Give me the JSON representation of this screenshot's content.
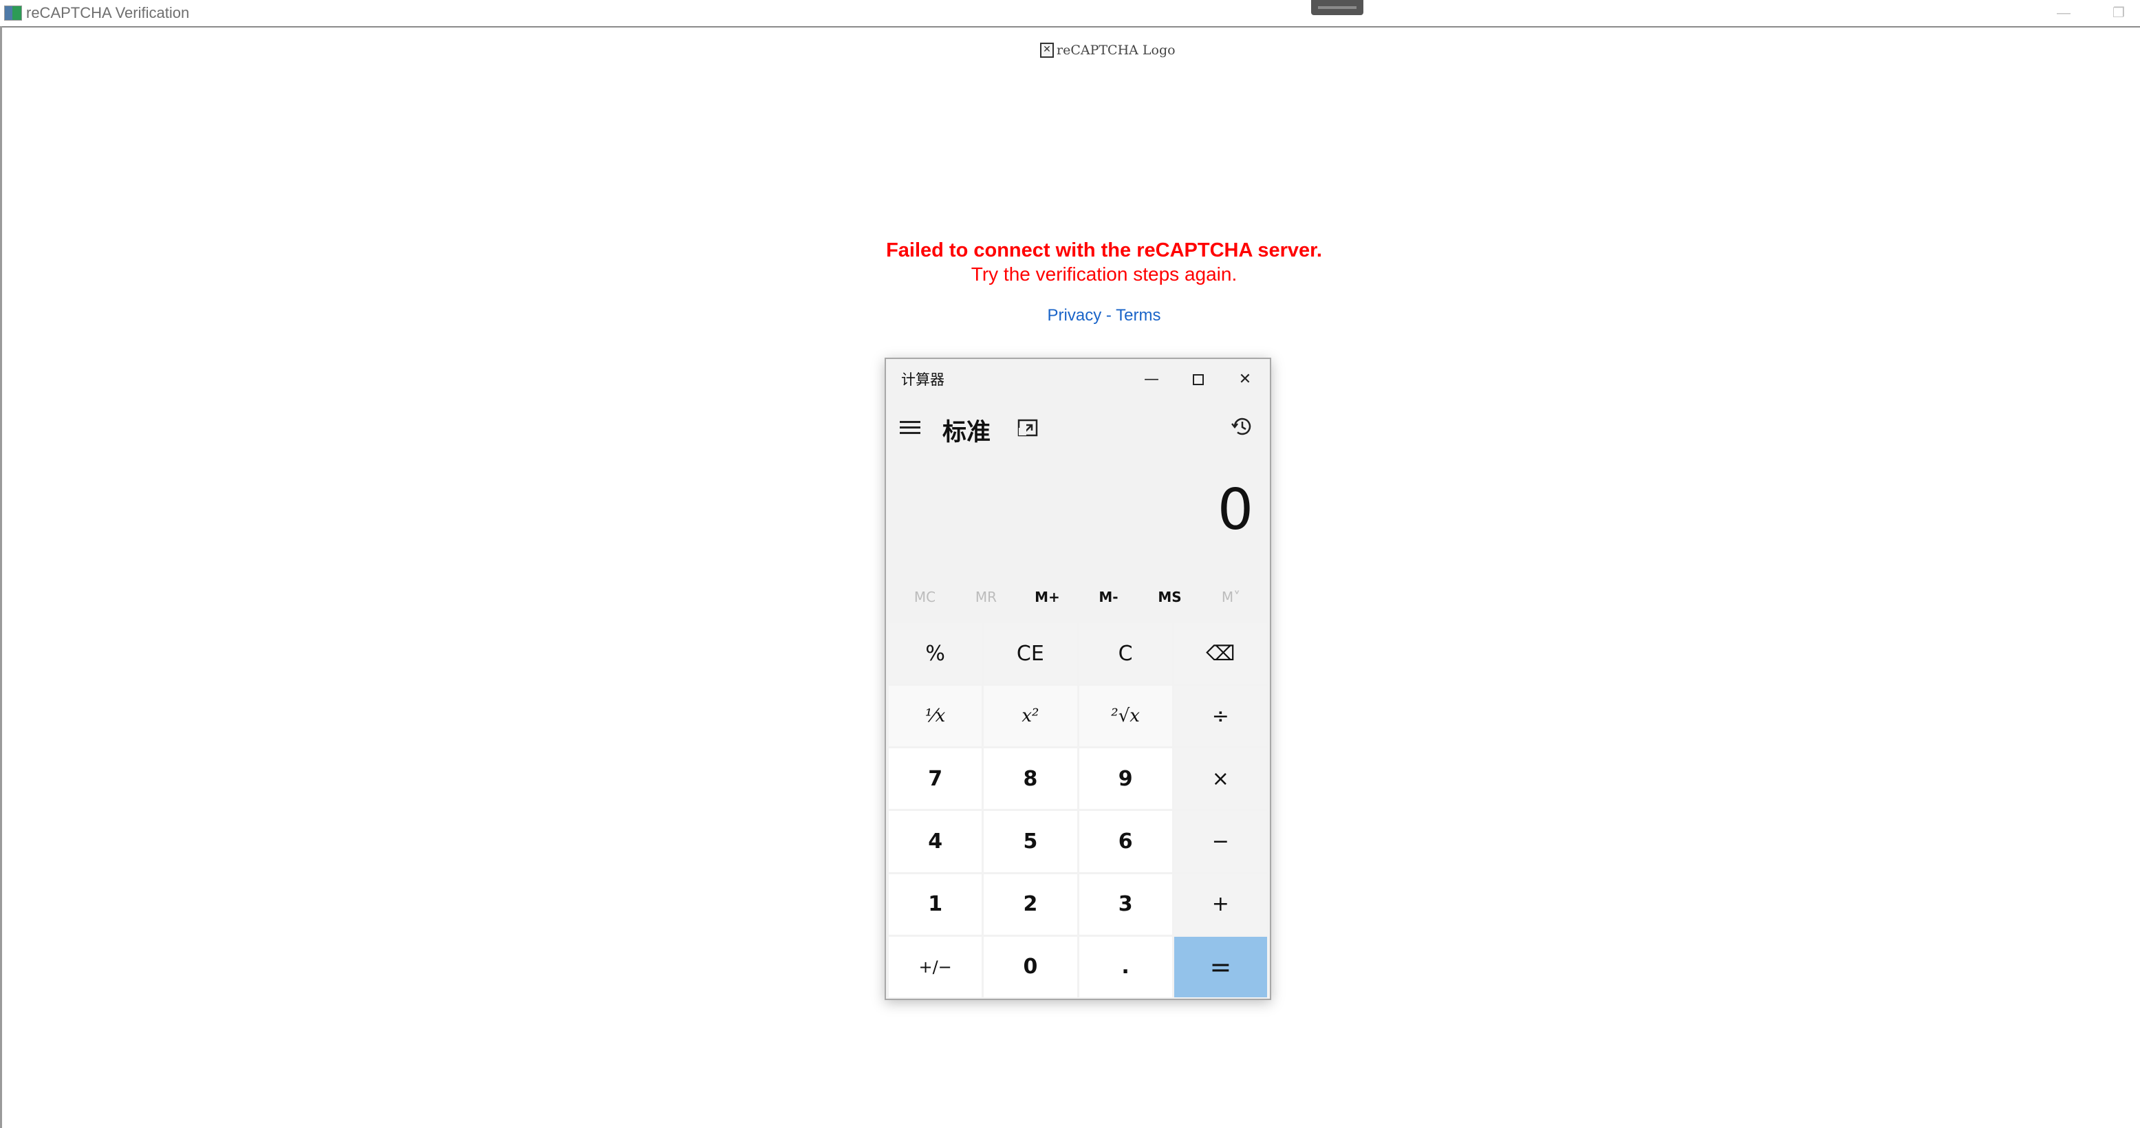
{
  "window": {
    "title": "reCAPTCHA Verification",
    "minimize_glyph": "—",
    "restore_glyph": "❐"
  },
  "page": {
    "logo_alt": "reCAPTCHA Logo",
    "error_title": "Failed to connect with the reCAPTCHA server.",
    "error_subtitle": "Try the verification steps again.",
    "privacy_link": "Privacy",
    "link_separator": " - ",
    "terms_link": "Terms"
  },
  "calculator": {
    "window_title": "计算器",
    "mode_title": "标准",
    "display_value": "0",
    "window_buttons": {
      "minimize": "—",
      "close": "✕"
    },
    "memory": [
      {
        "label": "MC",
        "enabled": false
      },
      {
        "label": "MR",
        "enabled": false
      },
      {
        "label": "M+",
        "enabled": true
      },
      {
        "label": "M-",
        "enabled": true
      },
      {
        "label": "MS",
        "enabled": true
      },
      {
        "label": "M˅",
        "enabled": false
      }
    ],
    "keys": [
      {
        "label": "%",
        "kind": "op",
        "name": "percent-button"
      },
      {
        "label": "CE",
        "kind": "op",
        "name": "clear-entry-button"
      },
      {
        "label": "C",
        "kind": "op",
        "name": "clear-button"
      },
      {
        "label": "⌫",
        "kind": "op",
        "name": "backspace-button"
      },
      {
        "label": "⅟x",
        "kind": "fn",
        "name": "reciprocal-button"
      },
      {
        "label": "x²",
        "kind": "fn",
        "name": "square-button"
      },
      {
        "label": "²√x",
        "kind": "fn",
        "name": "square-root-button"
      },
      {
        "label": "÷",
        "kind": "op",
        "name": "divide-button"
      },
      {
        "label": "7",
        "kind": "num",
        "name": "digit-7-button"
      },
      {
        "label": "8",
        "kind": "num",
        "name": "digit-8-button"
      },
      {
        "label": "9",
        "kind": "num",
        "name": "digit-9-button"
      },
      {
        "label": "×",
        "kind": "op",
        "name": "multiply-button"
      },
      {
        "label": "4",
        "kind": "num",
        "name": "digit-4-button"
      },
      {
        "label": "5",
        "kind": "num",
        "name": "digit-5-button"
      },
      {
        "label": "6",
        "kind": "num",
        "name": "digit-6-button"
      },
      {
        "label": "−",
        "kind": "op",
        "name": "subtract-button"
      },
      {
        "label": "1",
        "kind": "num",
        "name": "digit-1-button"
      },
      {
        "label": "2",
        "kind": "num",
        "name": "digit-2-button"
      },
      {
        "label": "3",
        "kind": "num",
        "name": "digit-3-button"
      },
      {
        "label": "+",
        "kind": "op",
        "name": "add-button"
      },
      {
        "label": "+/−",
        "kind": "num-alt",
        "name": "negate-button"
      },
      {
        "label": "0",
        "kind": "num",
        "name": "digit-0-button"
      },
      {
        "label": ".",
        "kind": "num",
        "name": "decimal-button"
      },
      {
        "label": "=",
        "kind": "equals",
        "name": "equals-button"
      }
    ],
    "colors": {
      "equals_key": "#93c2ea",
      "error_text": "#ff0000",
      "link_text": "#1a64c8"
    }
  }
}
